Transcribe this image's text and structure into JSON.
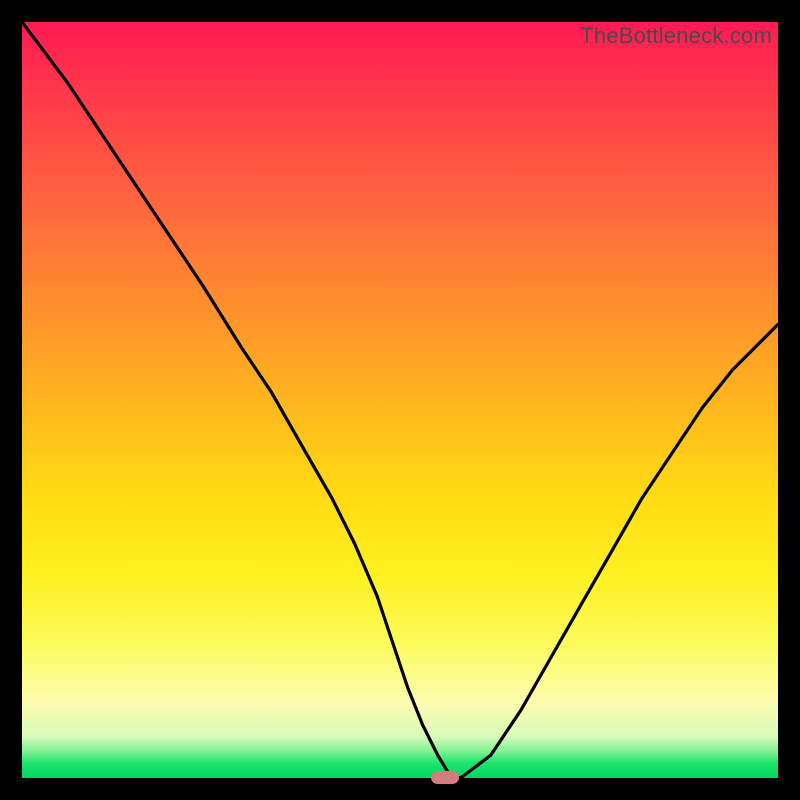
{
  "watermark": "TheBottleneck.com",
  "colors": {
    "frame": "#000000",
    "curve_stroke": "#000000",
    "marker_fill": "#d57a7d",
    "gradient_top": "#ff1a54",
    "gradient_mid": "#ffd914",
    "gradient_bottom": "#00d860"
  },
  "chart_data": {
    "type": "line",
    "title": "",
    "xlabel": "",
    "ylabel": "",
    "xlim": [
      0,
      100
    ],
    "ylim": [
      0,
      100
    ],
    "series": [
      {
        "name": "bottleneck-curve",
        "x": [
          0,
          6,
          12,
          18,
          24,
          29,
          33,
          37,
          41,
          44,
          47,
          49,
          51,
          53,
          55,
          56.5,
          58,
          62,
          66,
          70,
          74,
          78,
          82,
          86,
          90,
          94,
          98,
          100
        ],
        "y": [
          100,
          92,
          83,
          74,
          65,
          57,
          51,
          44,
          37,
          31,
          24,
          18,
          12,
          7,
          3,
          0.5,
          0,
          3,
          9,
          16,
          23,
          30,
          37,
          43,
          49,
          54,
          58,
          60
        ]
      }
    ],
    "marker": {
      "x": 56,
      "y": 0.2,
      "shape": "pill"
    },
    "notes": "y=0 is the bottom green band (no bottleneck); y=100 is the top red edge. x is relative horizontal position across the plot. The curve dips to ~0 around x≈56–58 then rises again to ~60 at right edge."
  }
}
